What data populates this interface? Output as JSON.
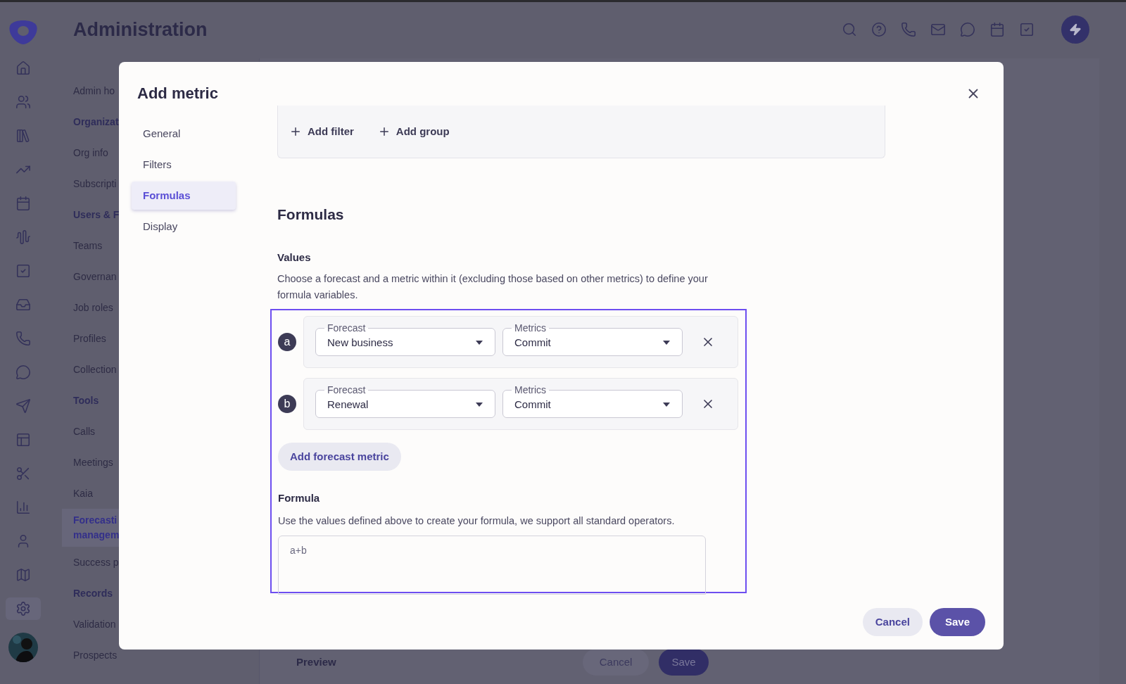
{
  "app": {
    "title": "Administration"
  },
  "rail": {
    "items": [
      {
        "selected": false
      },
      {
        "selected": false
      },
      {
        "selected": false
      },
      {
        "selected": false
      },
      {
        "selected": false
      },
      {
        "selected": false
      },
      {
        "selected": false
      },
      {
        "selected": false
      },
      {
        "selected": false
      },
      {
        "selected": false
      },
      {
        "selected": false
      },
      {
        "selected": false
      },
      {
        "selected": false
      },
      {
        "selected": false
      },
      {
        "selected": false
      },
      {
        "selected": false
      },
      {
        "selected": true
      }
    ]
  },
  "nav": {
    "items": [
      {
        "kind": "item",
        "label": "Admin ho",
        "selected": false
      },
      {
        "kind": "heading",
        "label": "Organizat"
      },
      {
        "kind": "item",
        "label": "Org info",
        "selected": false
      },
      {
        "kind": "item",
        "label": "Subscripti",
        "selected": false
      },
      {
        "kind": "heading",
        "label": "Users & F"
      },
      {
        "kind": "item",
        "label": "Teams",
        "selected": false
      },
      {
        "kind": "item",
        "label": "Governan",
        "selected": false
      },
      {
        "kind": "item",
        "label": "Job roles",
        "selected": false
      },
      {
        "kind": "item",
        "label": "Profiles",
        "selected": false
      },
      {
        "kind": "item",
        "label": "Collection",
        "selected": false
      },
      {
        "kind": "heading",
        "label": "Tools"
      },
      {
        "kind": "item",
        "label": "Calls",
        "selected": false
      },
      {
        "kind": "item",
        "label": "Meetings",
        "selected": false
      },
      {
        "kind": "item",
        "label": "Kaia",
        "selected": false
      },
      {
        "kind": "item",
        "label": "Forecasti managem",
        "selected": true
      },
      {
        "kind": "item",
        "label": "Success p",
        "selected": false
      },
      {
        "kind": "heading",
        "label": "Records"
      },
      {
        "kind": "item",
        "label": "Validation",
        "selected": false
      },
      {
        "kind": "item",
        "label": "Prospects",
        "selected": false
      }
    ]
  },
  "page_footer": {
    "title": "Preview",
    "buttons": [
      "Cancel",
      "Save"
    ]
  },
  "dialog": {
    "title": "Add metric",
    "tabs": [
      {
        "label": "General",
        "selected": false
      },
      {
        "label": "Filters",
        "selected": false
      },
      {
        "label": "Formulas",
        "selected": true
      },
      {
        "label": "Display",
        "selected": false
      }
    ],
    "filter_actions": [
      "Add filter",
      "Add group"
    ],
    "section_title": "Formulas",
    "values": {
      "title": "Values",
      "description": "Choose a forecast and a metric within it (excluding those based on other metrics) to define your formula variables.",
      "rows": [
        {
          "letter": "a",
          "forecast_label": "Forecast",
          "forecast": "New business",
          "metric_label": "Metrics",
          "metric": "Commit"
        },
        {
          "letter": "b",
          "forecast_label": "Forecast",
          "forecast": "Renewal",
          "metric_label": "Metrics",
          "metric": "Commit"
        }
      ],
      "add_button": "Add forecast metric"
    },
    "formula": {
      "title": "Formula",
      "description": "Use the values defined above to create your formula, we support all standard operators.",
      "placeholder": "a+b"
    },
    "buttons": [
      "Cancel",
      "Save"
    ]
  }
}
